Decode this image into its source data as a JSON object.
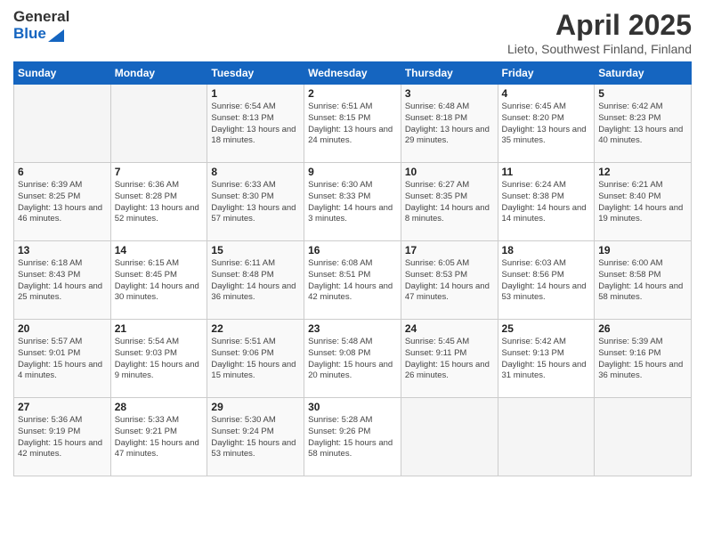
{
  "logo": {
    "general": "General",
    "blue": "Blue"
  },
  "title": "April 2025",
  "subtitle": "Lieto, Southwest Finland, Finland",
  "weekdays": [
    "Sunday",
    "Monday",
    "Tuesday",
    "Wednesday",
    "Thursday",
    "Friday",
    "Saturday"
  ],
  "weeks": [
    [
      null,
      null,
      {
        "day": 1,
        "sunrise": "6:54 AM",
        "sunset": "8:13 PM",
        "daylight": "13 hours and 18 minutes."
      },
      {
        "day": 2,
        "sunrise": "6:51 AM",
        "sunset": "8:15 PM",
        "daylight": "13 hours and 24 minutes."
      },
      {
        "day": 3,
        "sunrise": "6:48 AM",
        "sunset": "8:18 PM",
        "daylight": "13 hours and 29 minutes."
      },
      {
        "day": 4,
        "sunrise": "6:45 AM",
        "sunset": "8:20 PM",
        "daylight": "13 hours and 35 minutes."
      },
      {
        "day": 5,
        "sunrise": "6:42 AM",
        "sunset": "8:23 PM",
        "daylight": "13 hours and 40 minutes."
      }
    ],
    [
      {
        "day": 6,
        "sunrise": "6:39 AM",
        "sunset": "8:25 PM",
        "daylight": "13 hours and 46 minutes."
      },
      {
        "day": 7,
        "sunrise": "6:36 AM",
        "sunset": "8:28 PM",
        "daylight": "13 hours and 52 minutes."
      },
      {
        "day": 8,
        "sunrise": "6:33 AM",
        "sunset": "8:30 PM",
        "daylight": "13 hours and 57 minutes."
      },
      {
        "day": 9,
        "sunrise": "6:30 AM",
        "sunset": "8:33 PM",
        "daylight": "14 hours and 3 minutes."
      },
      {
        "day": 10,
        "sunrise": "6:27 AM",
        "sunset": "8:35 PM",
        "daylight": "14 hours and 8 minutes."
      },
      {
        "day": 11,
        "sunrise": "6:24 AM",
        "sunset": "8:38 PM",
        "daylight": "14 hours and 14 minutes."
      },
      {
        "day": 12,
        "sunrise": "6:21 AM",
        "sunset": "8:40 PM",
        "daylight": "14 hours and 19 minutes."
      }
    ],
    [
      {
        "day": 13,
        "sunrise": "6:18 AM",
        "sunset": "8:43 PM",
        "daylight": "14 hours and 25 minutes."
      },
      {
        "day": 14,
        "sunrise": "6:15 AM",
        "sunset": "8:45 PM",
        "daylight": "14 hours and 30 minutes."
      },
      {
        "day": 15,
        "sunrise": "6:11 AM",
        "sunset": "8:48 PM",
        "daylight": "14 hours and 36 minutes."
      },
      {
        "day": 16,
        "sunrise": "6:08 AM",
        "sunset": "8:51 PM",
        "daylight": "14 hours and 42 minutes."
      },
      {
        "day": 17,
        "sunrise": "6:05 AM",
        "sunset": "8:53 PM",
        "daylight": "14 hours and 47 minutes."
      },
      {
        "day": 18,
        "sunrise": "6:03 AM",
        "sunset": "8:56 PM",
        "daylight": "14 hours and 53 minutes."
      },
      {
        "day": 19,
        "sunrise": "6:00 AM",
        "sunset": "8:58 PM",
        "daylight": "14 hours and 58 minutes."
      }
    ],
    [
      {
        "day": 20,
        "sunrise": "5:57 AM",
        "sunset": "9:01 PM",
        "daylight": "15 hours and 4 minutes."
      },
      {
        "day": 21,
        "sunrise": "5:54 AM",
        "sunset": "9:03 PM",
        "daylight": "15 hours and 9 minutes."
      },
      {
        "day": 22,
        "sunrise": "5:51 AM",
        "sunset": "9:06 PM",
        "daylight": "15 hours and 15 minutes."
      },
      {
        "day": 23,
        "sunrise": "5:48 AM",
        "sunset": "9:08 PM",
        "daylight": "15 hours and 20 minutes."
      },
      {
        "day": 24,
        "sunrise": "5:45 AM",
        "sunset": "9:11 PM",
        "daylight": "15 hours and 26 minutes."
      },
      {
        "day": 25,
        "sunrise": "5:42 AM",
        "sunset": "9:13 PM",
        "daylight": "15 hours and 31 minutes."
      },
      {
        "day": 26,
        "sunrise": "5:39 AM",
        "sunset": "9:16 PM",
        "daylight": "15 hours and 36 minutes."
      }
    ],
    [
      {
        "day": 27,
        "sunrise": "5:36 AM",
        "sunset": "9:19 PM",
        "daylight": "15 hours and 42 minutes."
      },
      {
        "day": 28,
        "sunrise": "5:33 AM",
        "sunset": "9:21 PM",
        "daylight": "15 hours and 47 minutes."
      },
      {
        "day": 29,
        "sunrise": "5:30 AM",
        "sunset": "9:24 PM",
        "daylight": "15 hours and 53 minutes."
      },
      {
        "day": 30,
        "sunrise": "5:28 AM",
        "sunset": "9:26 PM",
        "daylight": "15 hours and 58 minutes."
      },
      null,
      null,
      null
    ]
  ]
}
